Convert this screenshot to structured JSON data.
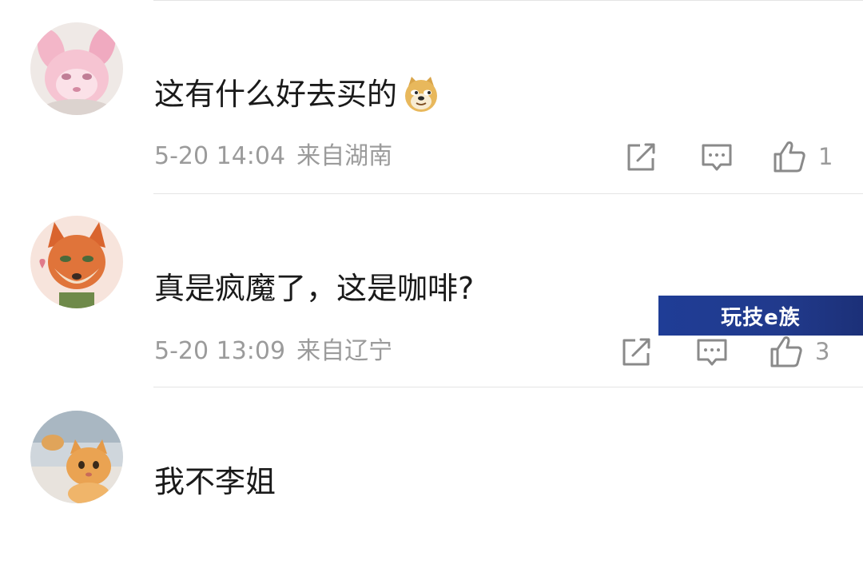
{
  "comments": [
    {
      "avatar_icon": "pink-bunny-avatar",
      "text": "这有什么好去买的",
      "emoji_icon": "doge-emoji",
      "date": "5-20 14:04",
      "location": "来自湖南",
      "like_count": "1"
    },
    {
      "avatar_icon": "fox-avatar",
      "text": "真是疯魔了，这是咖啡?",
      "date": "5-20 13:09",
      "location": "来自辽宁",
      "like_count": "3"
    },
    {
      "avatar_icon": "cat-avatar",
      "text": "我不李姐"
    }
  ],
  "watermark": {
    "text": "玩技e族",
    "color": "#213a8c"
  },
  "colors": {
    "text": "#1a1a1a",
    "meta": "#9b9b9b",
    "divider": "#e4e4e4"
  }
}
